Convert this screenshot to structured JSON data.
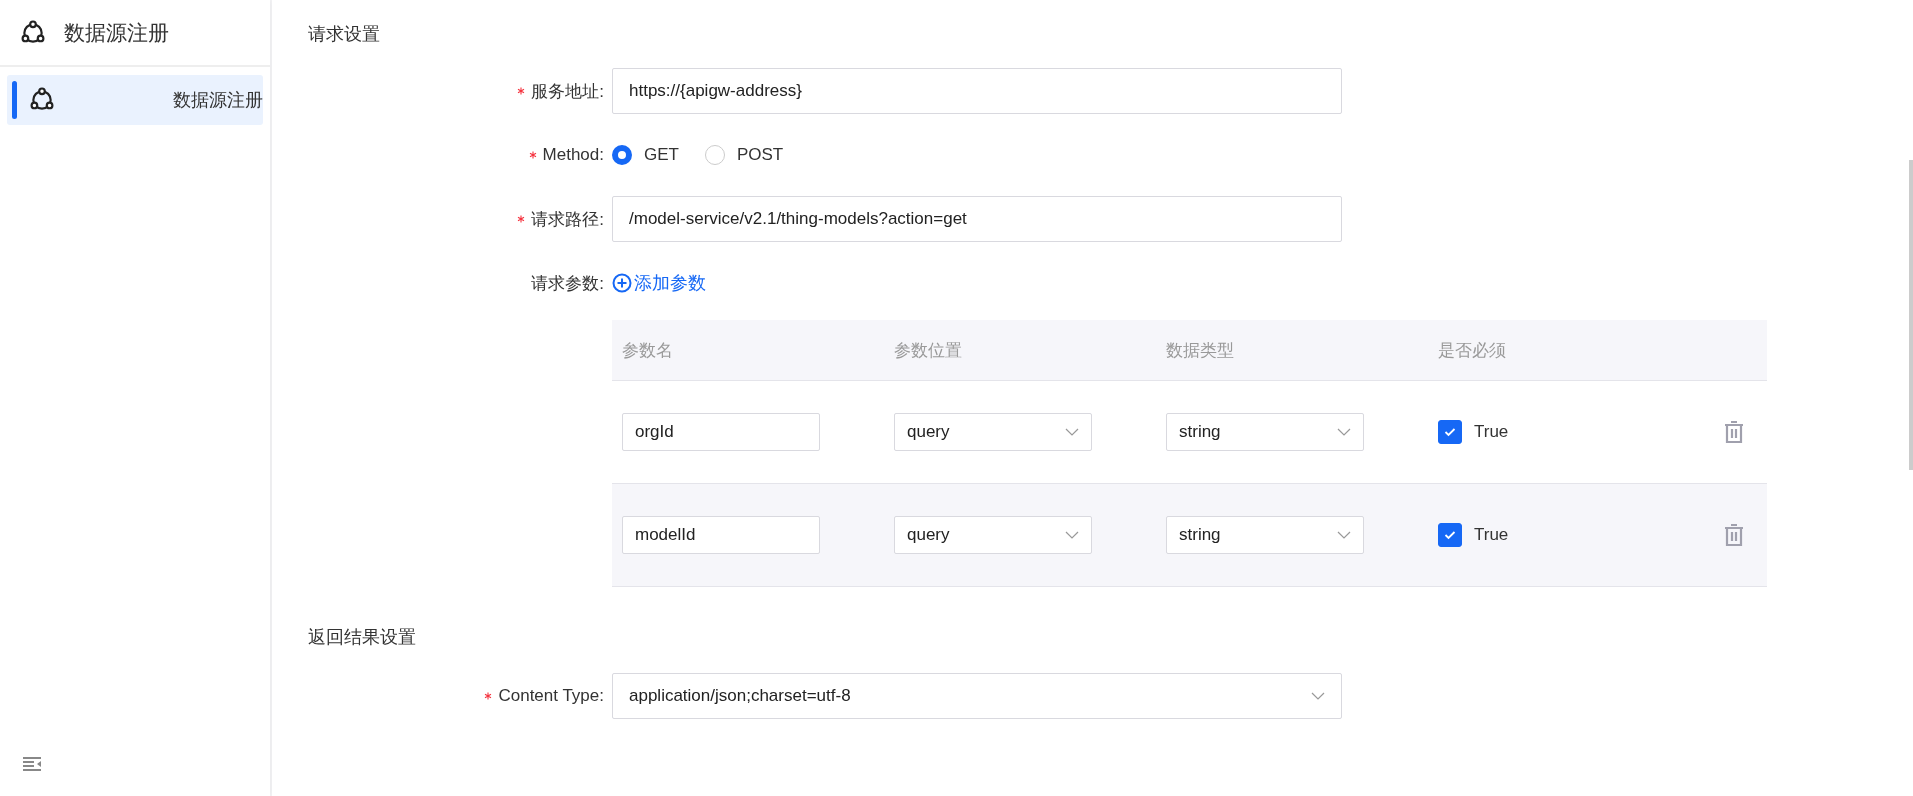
{
  "sidebar": {
    "title": "数据源注册",
    "items": [
      {
        "label": "数据源注册",
        "selected": true
      }
    ]
  },
  "request_section": {
    "title": "请求设置",
    "fields": [
      {
        "kind": "input",
        "label": "服务地址:",
        "required": true,
        "value": "https://{apigw-address}"
      },
      {
        "kind": "radio",
        "label": "Method:",
        "required": true,
        "options": [
          {
            "label": "GET",
            "selected": true
          },
          {
            "label": "POST",
            "selected": false
          }
        ]
      },
      {
        "kind": "input",
        "label": "请求路径:",
        "required": true,
        "value": "/model-service/v2.1/thing-models?action=get"
      },
      {
        "kind": "params",
        "label": "请求参数:",
        "required": false,
        "add_link": "添加参数"
      }
    ]
  },
  "params_table": {
    "columns": [
      "参数名",
      "参数位置",
      "数据类型",
      "是否必须"
    ],
    "rows": [
      {
        "name": "orgId",
        "position": "query",
        "type": "string",
        "required": {
          "checked": true,
          "label": "True"
        }
      },
      {
        "name": "modelId",
        "position": "query",
        "type": "string",
        "required": {
          "checked": true,
          "label": "True"
        }
      }
    ]
  },
  "response_section": {
    "title": "返回结果设置",
    "fields": [
      {
        "kind": "select",
        "label": "Content Type:",
        "required": true,
        "value": "application/json;charset=utf-8"
      }
    ]
  }
}
